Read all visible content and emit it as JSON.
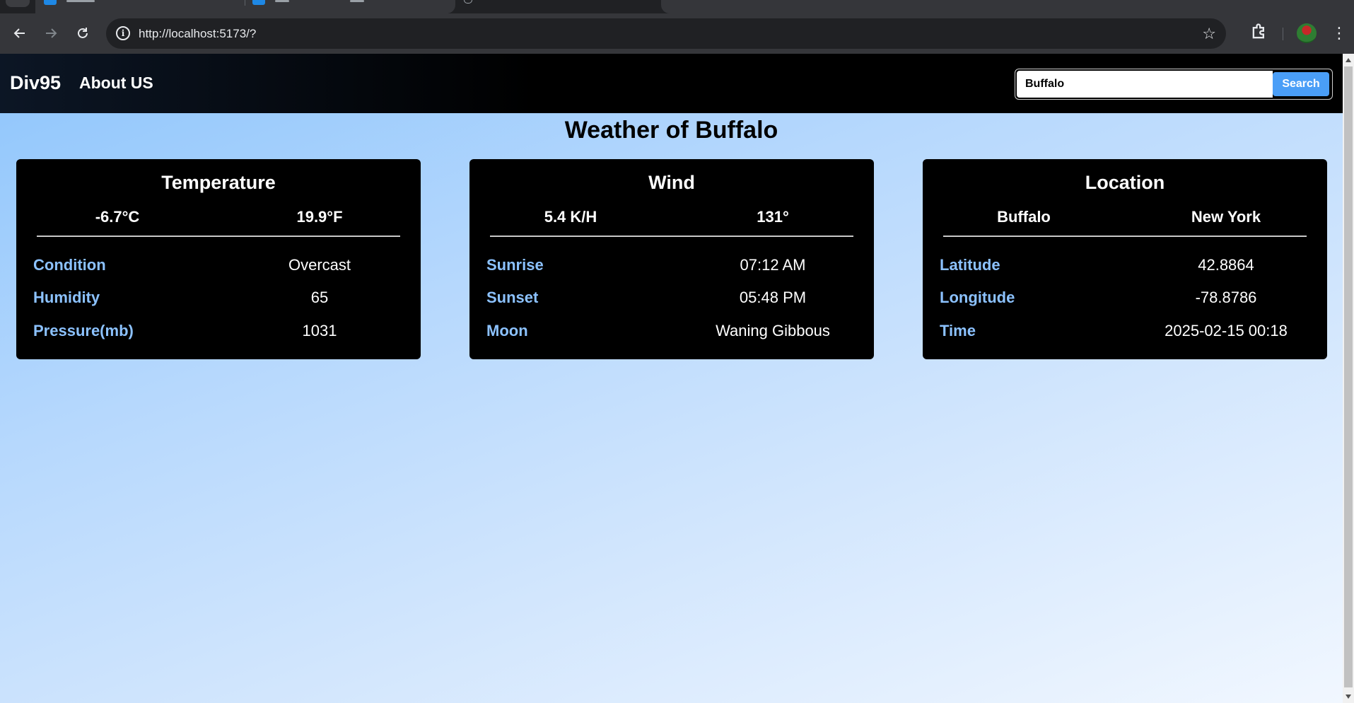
{
  "browser": {
    "url": "http://localhost:5173/?"
  },
  "nav": {
    "brand": "Div95",
    "about": "About US",
    "search_value": "Buffalo",
    "search_button": "Search"
  },
  "page_title": "Weather of Buffalo",
  "cards": {
    "temperature": {
      "title": "Temperature",
      "sub_left": "-6.7°C",
      "sub_right": "19.9°F",
      "rows": [
        {
          "label": "Condition",
          "value": "Overcast"
        },
        {
          "label": "Humidity",
          "value": "65"
        },
        {
          "label": "Pressure(mb)",
          "value": "1031"
        }
      ]
    },
    "wind": {
      "title": "Wind",
      "sub_left": "5.4 K/H",
      "sub_right": "131°",
      "rows": [
        {
          "label": "Sunrise",
          "value": "07:12 AM"
        },
        {
          "label": "Sunset",
          "value": "05:48 PM"
        },
        {
          "label": "Moon",
          "value": "Waning Gibbous"
        }
      ]
    },
    "location": {
      "title": "Location",
      "sub_left": "Buffalo",
      "sub_right": "New York",
      "rows": [
        {
          "label": "Latitude",
          "value": "42.8864"
        },
        {
          "label": "Longitude",
          "value": "-78.8786"
        },
        {
          "label": "Time",
          "value": "2025-02-15 00:18"
        }
      ]
    }
  },
  "colors": {
    "label_blue": "#8cc2ff",
    "search_button": "#4a9ef7",
    "card_bg": "#000000"
  }
}
